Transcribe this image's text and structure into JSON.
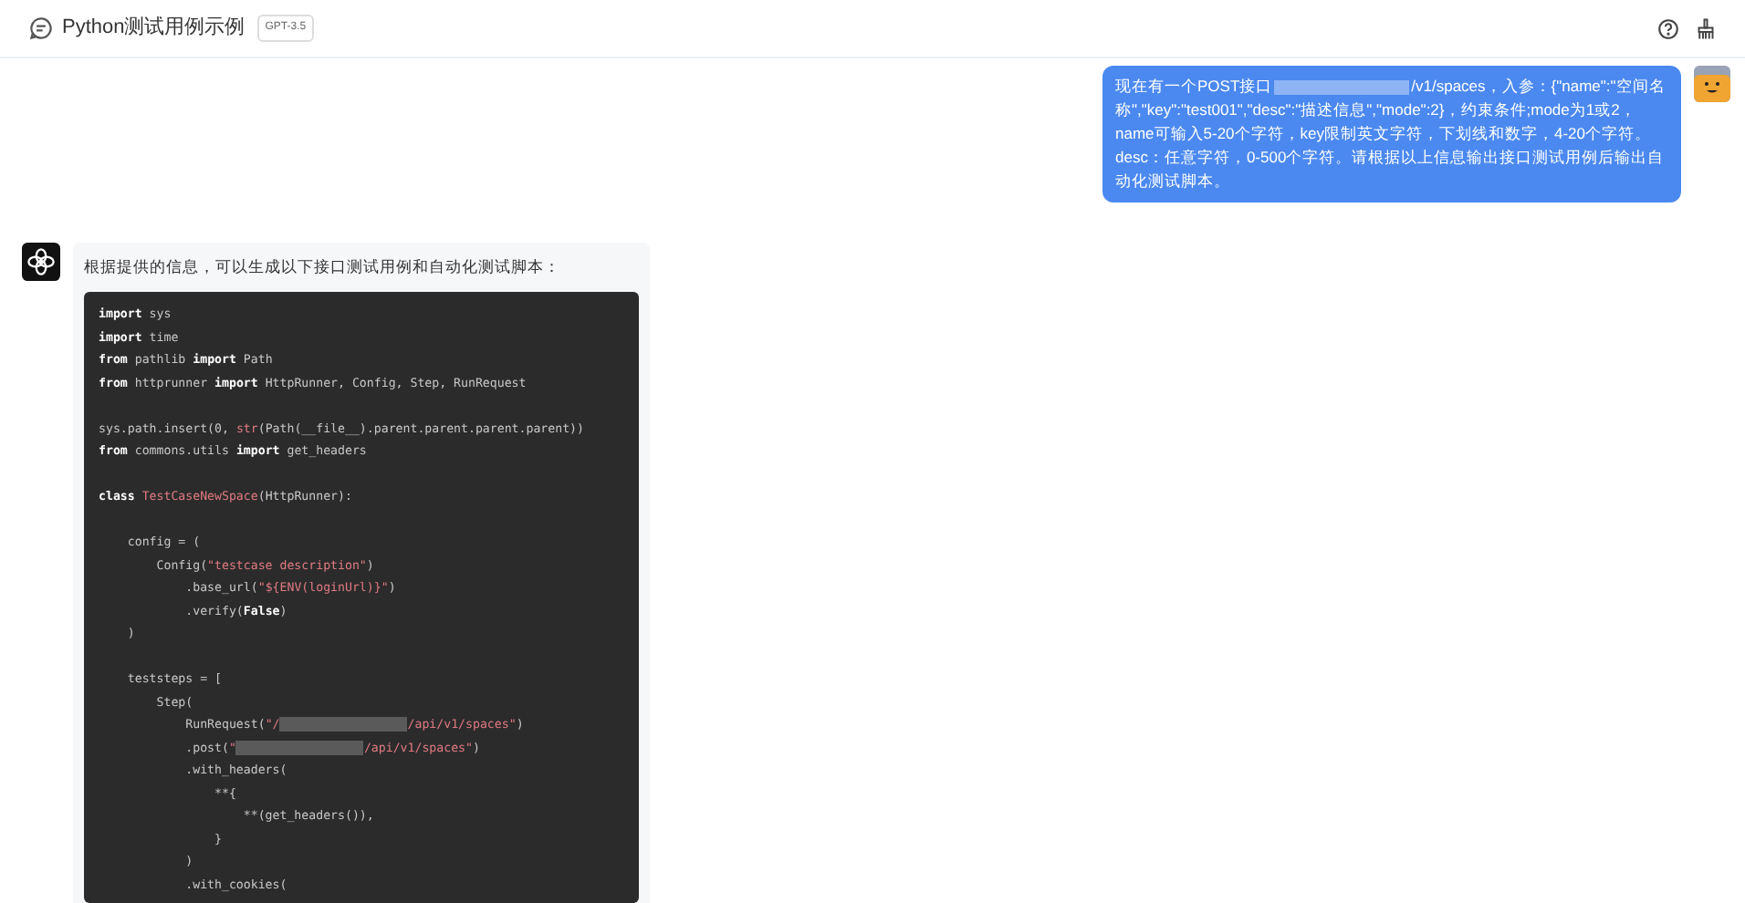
{
  "header": {
    "title": "Python测试用例示例",
    "model_badge": "GPT-3.5"
  },
  "user_message": {
    "parts": [
      {
        "kind": "text",
        "text": "现在有一个POST接口"
      },
      {
        "kind": "redacted"
      },
      {
        "kind": "text",
        "text": "/v1/spaces，入参：{\"name\":\"空间名称\",\"key\":\"test001\",\"desc\":\"描述信息\",\"mode\":2}，约束条件;mode为1或2，name可输入5-20个字符，key限制英文字符，下划线和数字，4-20个字符。desc：任意字符，0-500个字符。请根据以上信息输出接口测试用例后输出自动化测试脚本。"
      }
    ]
  },
  "assistant_message": {
    "intro": "根据提供的信息，可以生成以下接口测试用例和自动化测试脚本：",
    "code_paragraphs": [
      [
        [
          {
            "kind": "keyword",
            "text": "import"
          },
          {
            "kind": "plain",
            "text": " sys"
          }
        ],
        [
          {
            "kind": "keyword",
            "text": "import"
          },
          {
            "kind": "plain",
            "text": " time"
          }
        ],
        [
          {
            "kind": "keyword",
            "text": "from"
          },
          {
            "kind": "plain",
            "text": " pathlib "
          },
          {
            "kind": "keyword",
            "text": "import"
          },
          {
            "kind": "plain",
            "text": " Path"
          }
        ],
        [
          {
            "kind": "keyword",
            "text": "from"
          },
          {
            "kind": "plain",
            "text": " httprunner "
          },
          {
            "kind": "keyword",
            "text": "import"
          },
          {
            "kind": "plain",
            "text": " HttpRunner, Config, Step, RunRequest"
          }
        ]
      ],
      [
        [
          {
            "kind": "plain",
            "text": "sys.path.insert(0, "
          },
          {
            "kind": "builtin",
            "text": "str"
          },
          {
            "kind": "plain",
            "text": "(Path(__file__).parent.parent.parent.parent))"
          }
        ],
        [
          {
            "kind": "keyword",
            "text": "from"
          },
          {
            "kind": "plain",
            "text": " commons.utils "
          },
          {
            "kind": "keyword",
            "text": "import"
          },
          {
            "kind": "plain",
            "text": " get_headers"
          }
        ]
      ],
      [
        [
          {
            "kind": "keyword",
            "text": "class "
          },
          {
            "kind": "classname",
            "text": "TestCaseNewSpace"
          },
          {
            "kind": "plain",
            "text": "(HttpRunner):"
          }
        ]
      ],
      [
        [
          {
            "kind": "plain",
            "text": "    config = ("
          }
        ],
        [
          {
            "kind": "plain",
            "text": "        Config("
          },
          {
            "kind": "string",
            "text": "\"testcase description\""
          },
          {
            "kind": "plain",
            "text": ")"
          }
        ],
        [
          {
            "kind": "plain",
            "text": "            .base_url("
          },
          {
            "kind": "string",
            "text": "\"${ENV(loginUrl)}\""
          },
          {
            "kind": "plain",
            "text": ")"
          }
        ],
        [
          {
            "kind": "plain",
            "text": "            .verify("
          },
          {
            "kind": "keyword",
            "text": "False"
          },
          {
            "kind": "plain",
            "text": ")"
          }
        ],
        [
          {
            "kind": "plain",
            "text": "    )"
          }
        ]
      ],
      [
        [
          {
            "kind": "plain",
            "text": "    teststeps = ["
          }
        ],
        [
          {
            "kind": "plain",
            "text": "        Step("
          }
        ],
        [
          {
            "kind": "plain",
            "text": "            RunRequest("
          },
          {
            "kind": "string",
            "text": "\"/"
          },
          {
            "kind": "redacted"
          },
          {
            "kind": "string",
            "text": "/api/v1/spaces\""
          },
          {
            "kind": "plain",
            "text": ")"
          }
        ],
        [
          {
            "kind": "plain",
            "text": "            .post("
          },
          {
            "kind": "string",
            "text": "\""
          },
          {
            "kind": "redacted"
          },
          {
            "kind": "string",
            "text": "/api/v1/spaces\""
          },
          {
            "kind": "plain",
            "text": ")"
          }
        ],
        [
          {
            "kind": "plain",
            "text": "            .with_headers("
          }
        ],
        [
          {
            "kind": "plain",
            "text": "                **{"
          }
        ],
        [
          {
            "kind": "plain",
            "text": "                    **(get_headers()),"
          }
        ],
        [
          {
            "kind": "plain",
            "text": "                }"
          }
        ],
        [
          {
            "kind": "plain",
            "text": "            )"
          }
        ],
        [
          {
            "kind": "plain",
            "text": "            .with_cookies("
          }
        ]
      ]
    ]
  }
}
